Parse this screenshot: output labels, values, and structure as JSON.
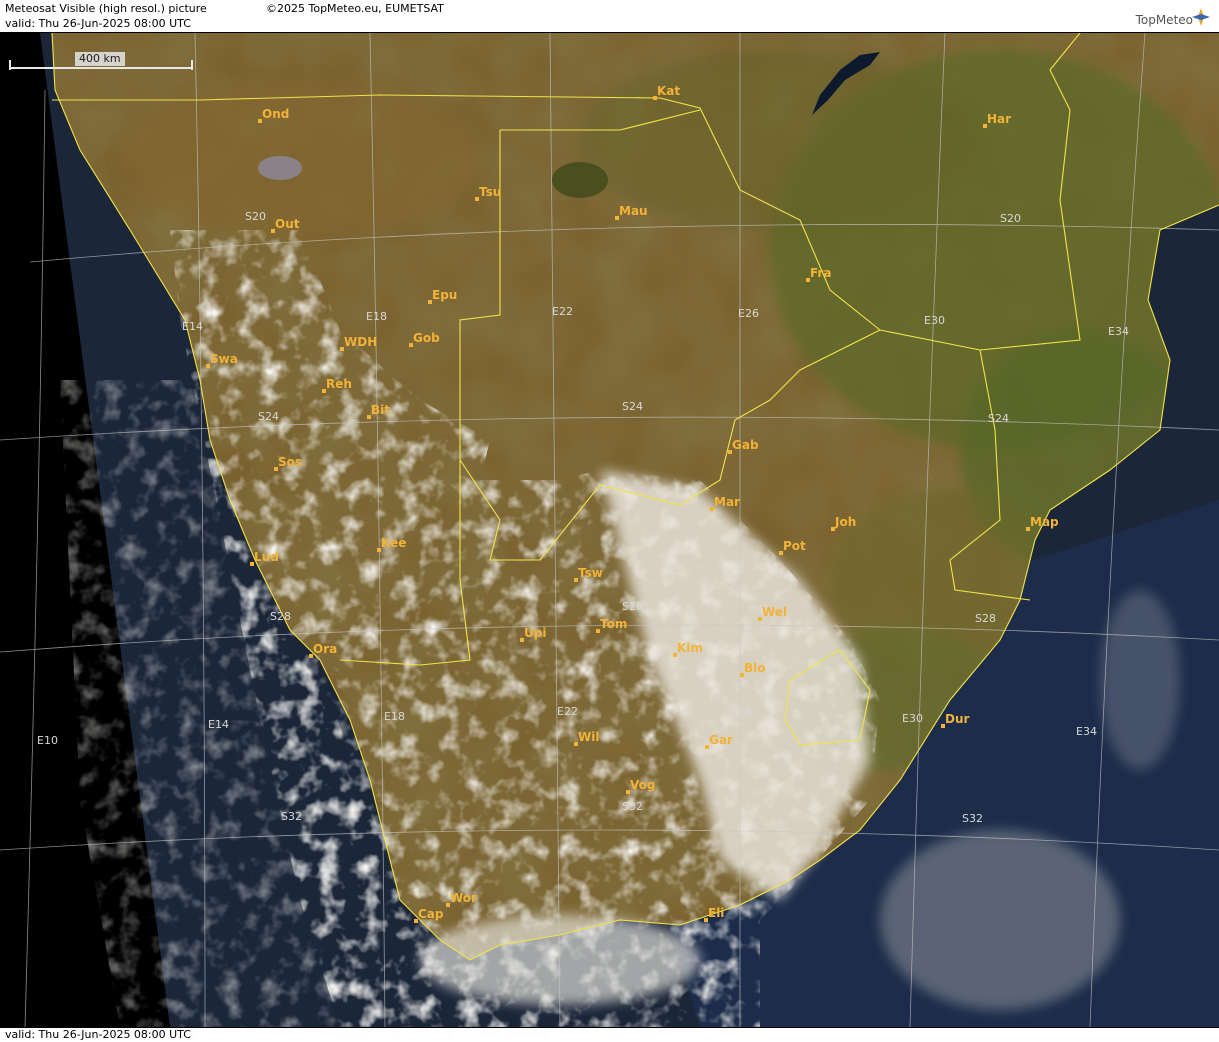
{
  "header": {
    "title": "Meteosat Visible (high resol.) picture",
    "copyright": "©2025 TopMeteo.eu, EUMETSAT",
    "valid": "valid:  Thu  26-Jun-2025  08:00 UTC"
  },
  "logo": {
    "text": "TopMeteo"
  },
  "scale_bar": {
    "label": "400 km"
  },
  "footer": {
    "valid": "valid:  Thu  26-Jun-2025  08:00 UTC"
  },
  "colors": {
    "ocean": "#1a2638",
    "land": "#7a6230",
    "vegetation": "#5a6a22",
    "cloud": "#e8e6e0",
    "border": "#f2e34a",
    "city": "#f2b338",
    "grid": "#c8c8c8"
  },
  "cities": [
    {
      "name": "Ond"
    },
    {
      "name": "Tsu"
    },
    {
      "name": "Out"
    },
    {
      "name": "Epu"
    },
    {
      "name": "WDH"
    },
    {
      "name": "Gob"
    },
    {
      "name": "Swa"
    },
    {
      "name": "Reh"
    },
    {
      "name": "Bit"
    },
    {
      "name": "Sos"
    },
    {
      "name": "Kee"
    },
    {
      "name": "Lud"
    },
    {
      "name": "Ora"
    },
    {
      "name": "Kat"
    },
    {
      "name": "Mau"
    },
    {
      "name": "Fra"
    },
    {
      "name": "Har"
    },
    {
      "name": "Gab"
    },
    {
      "name": "Mar"
    },
    {
      "name": "Joh"
    },
    {
      "name": "Pot"
    },
    {
      "name": "Map"
    },
    {
      "name": "Tsw"
    },
    {
      "name": "Wel"
    },
    {
      "name": "Tom"
    },
    {
      "name": "Upi"
    },
    {
      "name": "Kim"
    },
    {
      "name": "Blo"
    },
    {
      "name": "Dur"
    },
    {
      "name": "Wil"
    },
    {
      "name": "Gar"
    },
    {
      "name": "Vog"
    },
    {
      "name": "Wor"
    },
    {
      "name": "Cap"
    },
    {
      "name": "Eli"
    }
  ],
  "grid_labels": {
    "latitudes": [
      "S20",
      "S24",
      "S28",
      "S32"
    ],
    "longitudes": [
      "E10",
      "E14",
      "E18",
      "E22",
      "E26",
      "E30",
      "E34"
    ]
  }
}
